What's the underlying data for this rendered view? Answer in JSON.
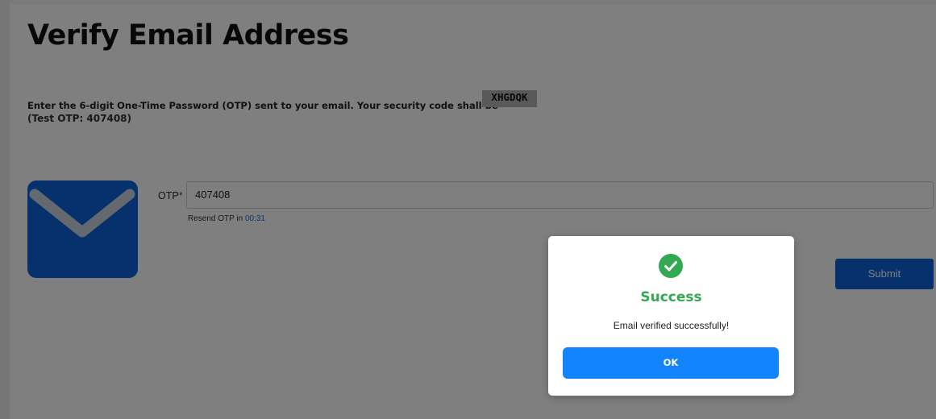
{
  "page": {
    "title": "Verify Email Address",
    "instructions": "Enter the 6-digit One-Time Password (OTP) sent to your email. Your security code shall be",
    "security_code": "XHGDQK",
    "test_otp": "(Test OTP: 407408)"
  },
  "form": {
    "otp_label": "OTP",
    "required_marker": "*",
    "otp_value": "407408",
    "resend_text": "Resend OTP in",
    "resend_timer": "00:31",
    "submit_label": "Submit"
  },
  "dialog": {
    "title": "Success",
    "message": "Email verified successfully!",
    "ok_label": "OK"
  },
  "colors": {
    "brand_blue": "#0d63d8",
    "success_green": "#34a853",
    "ok_button_blue": "#1283fb",
    "required_red": "#dd1111"
  },
  "icons": {
    "mail": "envelope-icon",
    "success": "check-circle-icon"
  }
}
